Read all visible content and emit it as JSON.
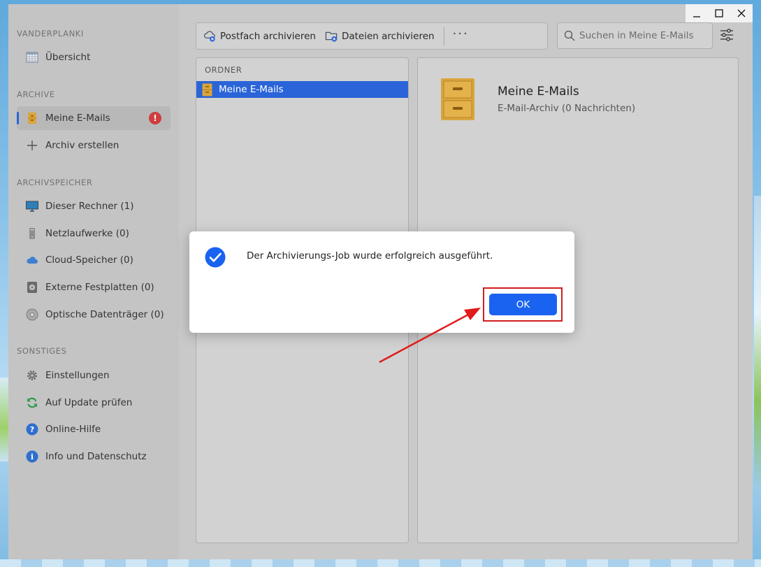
{
  "window": {
    "controls": {
      "minimize": "minimize",
      "maximize": "maximize",
      "close": "close"
    }
  },
  "sidebar": {
    "section_vanderplanki": "VANDERPLANKI",
    "overview_label": "Übersicht",
    "section_archive": "ARCHIVE",
    "archive_items": [
      {
        "label": "Meine E-Mails",
        "badge": "!",
        "active": true
      },
      {
        "label": "Archiv erstellen"
      }
    ],
    "section_storage": "ARCHIVSPEICHER",
    "storage_items": [
      {
        "label": "Dieser Rechner (1)",
        "icon": "monitor-icon"
      },
      {
        "label": "Netzlaufwerke (0)",
        "icon": "network-drive-icon"
      },
      {
        "label": "Cloud-Speicher (0)",
        "icon": "cloud-icon"
      },
      {
        "label": "Externe Festplatten (0)",
        "icon": "hard-drive-icon"
      },
      {
        "label": "Optische Datenträger (0)",
        "icon": "optical-disc-icon"
      }
    ],
    "section_other": "SONSTIGES",
    "other_items": [
      {
        "label": "Einstellungen",
        "icon": "gear-icon"
      },
      {
        "label": "Auf Update prüfen",
        "icon": "refresh-icon"
      },
      {
        "label": "Online-Hilfe",
        "icon": "help-icon"
      },
      {
        "label": "Info und Datenschutz",
        "icon": "info-icon"
      }
    ]
  },
  "toolbar": {
    "archive_mailbox": "Postfach archivieren",
    "archive_files": "Dateien archivieren",
    "more": "···"
  },
  "search": {
    "placeholder": "Suchen in Meine E-Mails"
  },
  "folders": {
    "header": "ORDNER",
    "items": [
      {
        "label": "Meine E-Mails",
        "selected": true
      }
    ]
  },
  "detail": {
    "title": "Meine E-Mails",
    "subtitle": "E-Mail-Archiv (0 Nachrichten)"
  },
  "dialog": {
    "message": "Der Archivierungs-Job wurde erfolgreich ausgeführt.",
    "ok_label": "OK"
  },
  "colors": {
    "accent": "#2a64d8",
    "ok_button": "#1a63f0",
    "error_badge": "#cf3e3e",
    "annotation": "#d21e1e",
    "archive_icon": "#d9a53c"
  }
}
